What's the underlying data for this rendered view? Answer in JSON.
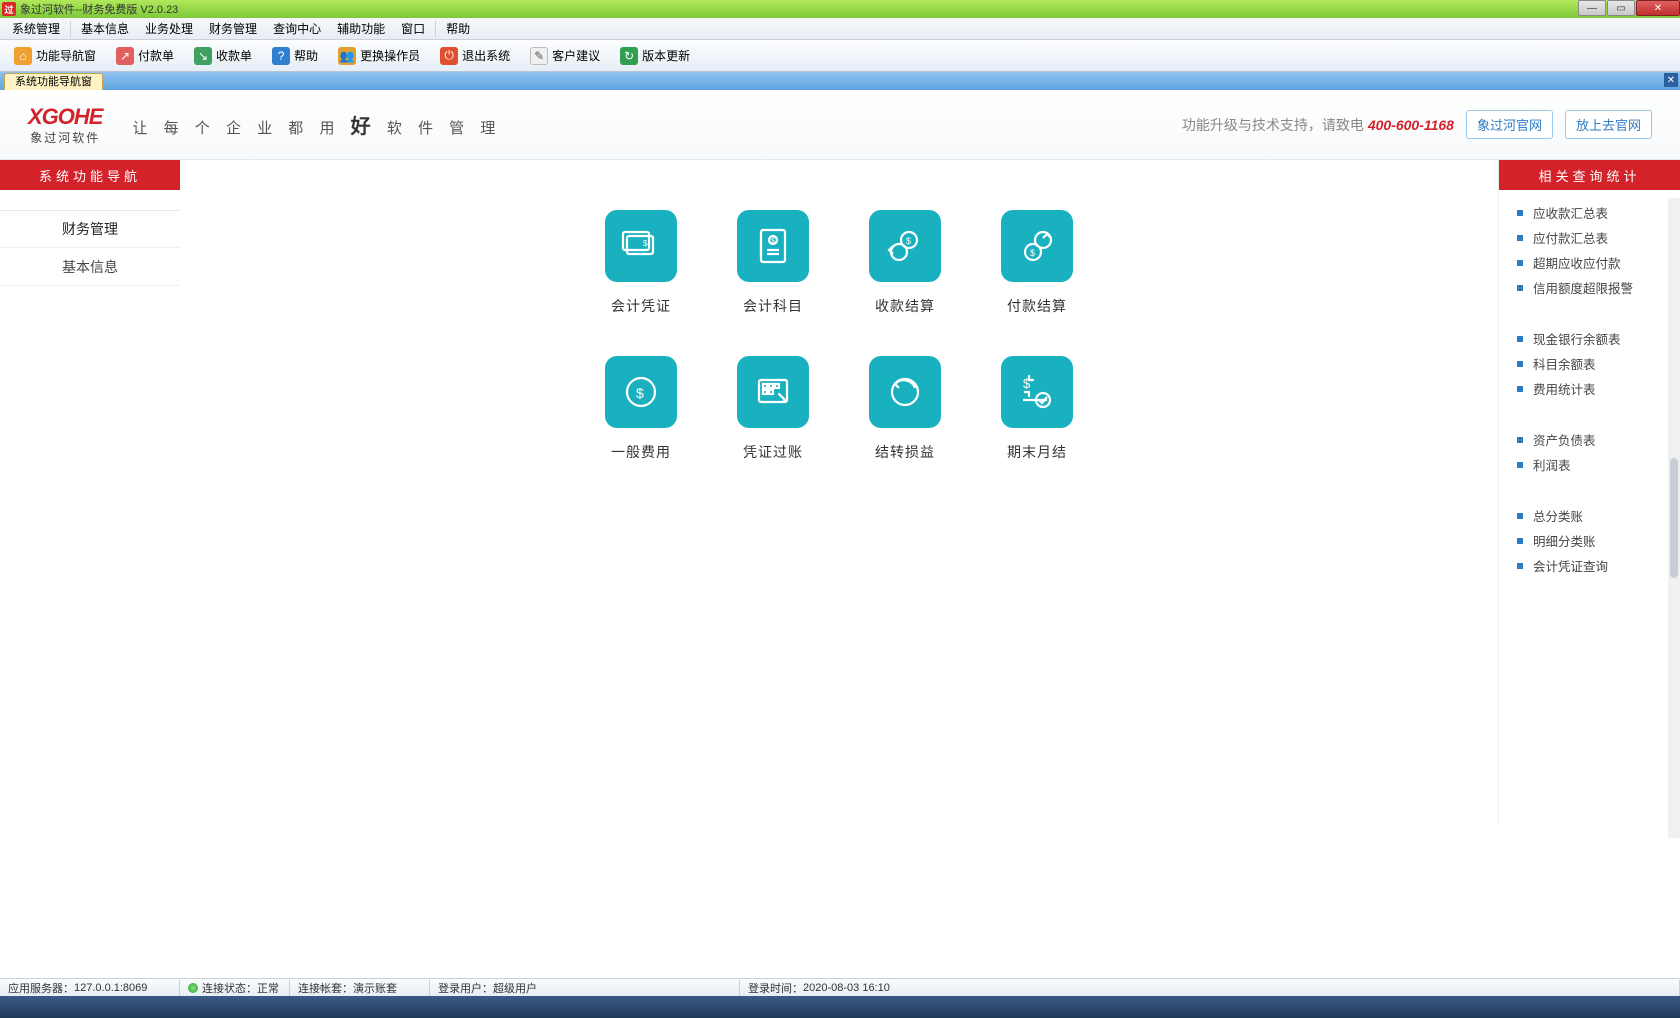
{
  "window": {
    "title": "象过河软件--财务免费版 V2.0.23"
  },
  "menu": [
    "系统管理",
    "基本信息",
    "业务处理",
    "财务管理",
    "查询中心",
    "辅助功能",
    "窗口",
    "帮助"
  ],
  "toolbar": [
    {
      "label": "功能导航窗",
      "key": "nav"
    },
    {
      "label": "付款单",
      "key": "pay"
    },
    {
      "label": "收款单",
      "key": "recv"
    },
    {
      "label": "帮助",
      "key": "help"
    },
    {
      "label": "更换操作员",
      "key": "switch"
    },
    {
      "label": "退出系统",
      "key": "exit"
    },
    {
      "label": "客户建议",
      "key": "suggest"
    },
    {
      "label": "版本更新",
      "key": "update"
    }
  ],
  "tab": {
    "active": "系统功能导航窗"
  },
  "header": {
    "logo_text": "XGOHE",
    "logo_sub": "象过河软件",
    "slogan_pre": "让 每 个 企 业 都 用",
    "slogan_big": "好",
    "slogan_post": "软 件 管 理",
    "support": "功能升级与技术支持，请致电",
    "phone": "400-600-1168",
    "btn1": "象过河官网",
    "btn2": "放上去官网"
  },
  "left": {
    "header": "系统功能导航",
    "items": [
      {
        "label": "财务管理",
        "active": true
      },
      {
        "label": "基本信息",
        "active": false
      }
    ]
  },
  "tiles": [
    {
      "label": "会计凭证",
      "key": "voucher"
    },
    {
      "label": "会计科目",
      "key": "subject"
    },
    {
      "label": "收款结算",
      "key": "recv-settle"
    },
    {
      "label": "付款结算",
      "key": "pay-settle"
    },
    {
      "label": "一般费用",
      "key": "expense"
    },
    {
      "label": "凭证过账",
      "key": "posting"
    },
    {
      "label": "结转损益",
      "key": "transfer"
    },
    {
      "label": "期末月结",
      "key": "close"
    }
  ],
  "right": {
    "header": "相关查询统计",
    "groups": [
      [
        "应收款汇总表",
        "应付款汇总表",
        "超期应收应付款",
        "信用额度超限报警"
      ],
      [
        "现金银行余额表",
        "科目余额表",
        "费用统计表"
      ],
      [
        "资产负债表",
        "利润表"
      ],
      [
        "总分类账",
        "明细分类账",
        "会计凭证查询"
      ]
    ]
  },
  "status": {
    "server_label": "应用服务器：",
    "server": "127.0.0.1:8069",
    "conn_label": "连接状态：",
    "conn": "正常",
    "acct_label": "连接帐套：",
    "acct": "演示账套",
    "user_label": "登录用户：",
    "user": "超级用户",
    "time_label": "登录时间：",
    "time": "2020-08-03 16:10"
  }
}
